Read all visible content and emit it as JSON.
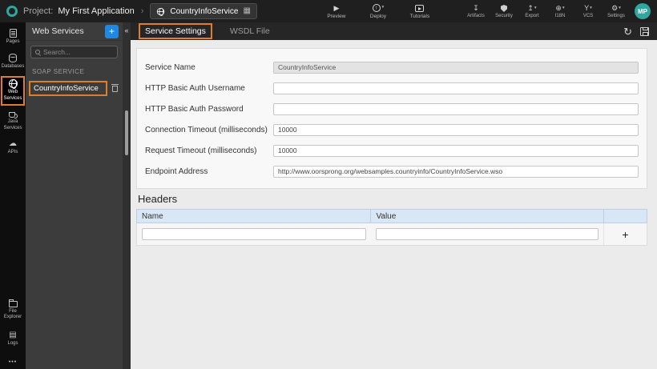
{
  "header": {
    "project_label": "Project:",
    "project_name": "My First Application",
    "separator": "›",
    "service_box": {
      "name": "CountryInfoService"
    },
    "primary_actions": [
      {
        "label": "Preview"
      },
      {
        "label": "Deploy"
      },
      {
        "label": "Tutorials"
      }
    ],
    "tool_actions": [
      {
        "label": "Artifacts"
      },
      {
        "label": "Security"
      },
      {
        "label": "Export"
      },
      {
        "label": "I18N"
      },
      {
        "label": "VCS"
      },
      {
        "label": "Settings"
      }
    ],
    "avatar_initials": "MP"
  },
  "rail": {
    "items": [
      {
        "label": "Pages"
      },
      {
        "label": "Databases"
      },
      {
        "label": "Web Services"
      },
      {
        "label": "Java Services"
      },
      {
        "label": "APIs"
      }
    ],
    "bottom_items": [
      {
        "label": "File Explorer"
      },
      {
        "label": "Logs"
      }
    ],
    "overflow": "•••"
  },
  "sidebar": {
    "title": "Web Services",
    "add_button": "+",
    "collapse_icon": "«",
    "search_placeholder": "Search...",
    "section_title": "SOAP SERVICE",
    "items": [
      {
        "name": "CountryInfoService"
      }
    ]
  },
  "tabs": [
    {
      "label": "Service Settings",
      "active": true
    },
    {
      "label": "WSDL File",
      "active": false
    }
  ],
  "service_form": {
    "fields": [
      {
        "label": "Service Name",
        "value": "CountryInfoService"
      },
      {
        "label": "HTTP Basic Auth Username",
        "value": ""
      },
      {
        "label": "HTTP Basic Auth Password",
        "value": ""
      },
      {
        "label": "Connection Timeout (milliseconds)",
        "value": "10000"
      },
      {
        "label": "Request Timeout (milliseconds)",
        "value": "10000"
      },
      {
        "label": "Endpoint Address",
        "value": "http://www.oorsprong.org/websamples.countryinfo/CountryInfoService.wso"
      }
    ]
  },
  "headers_section": {
    "title": "Headers",
    "columns": [
      "Name",
      "Value"
    ],
    "add_button": "+"
  },
  "icons": {
    "play": "▶",
    "deploy_arrow": "↑",
    "caret": "▾",
    "artifacts": "↧",
    "export": "↥",
    "i18n": "⊕",
    "vcs": "Y",
    "settings": "⚙",
    "refresh": "↻",
    "grid": "▦",
    "cloud": "☁",
    "logs": "▤"
  },
  "colors": {
    "annotation_orange": "#dd7e2c",
    "accent_blue": "#1e88e5",
    "avatar_teal": "#2fa79e"
  }
}
